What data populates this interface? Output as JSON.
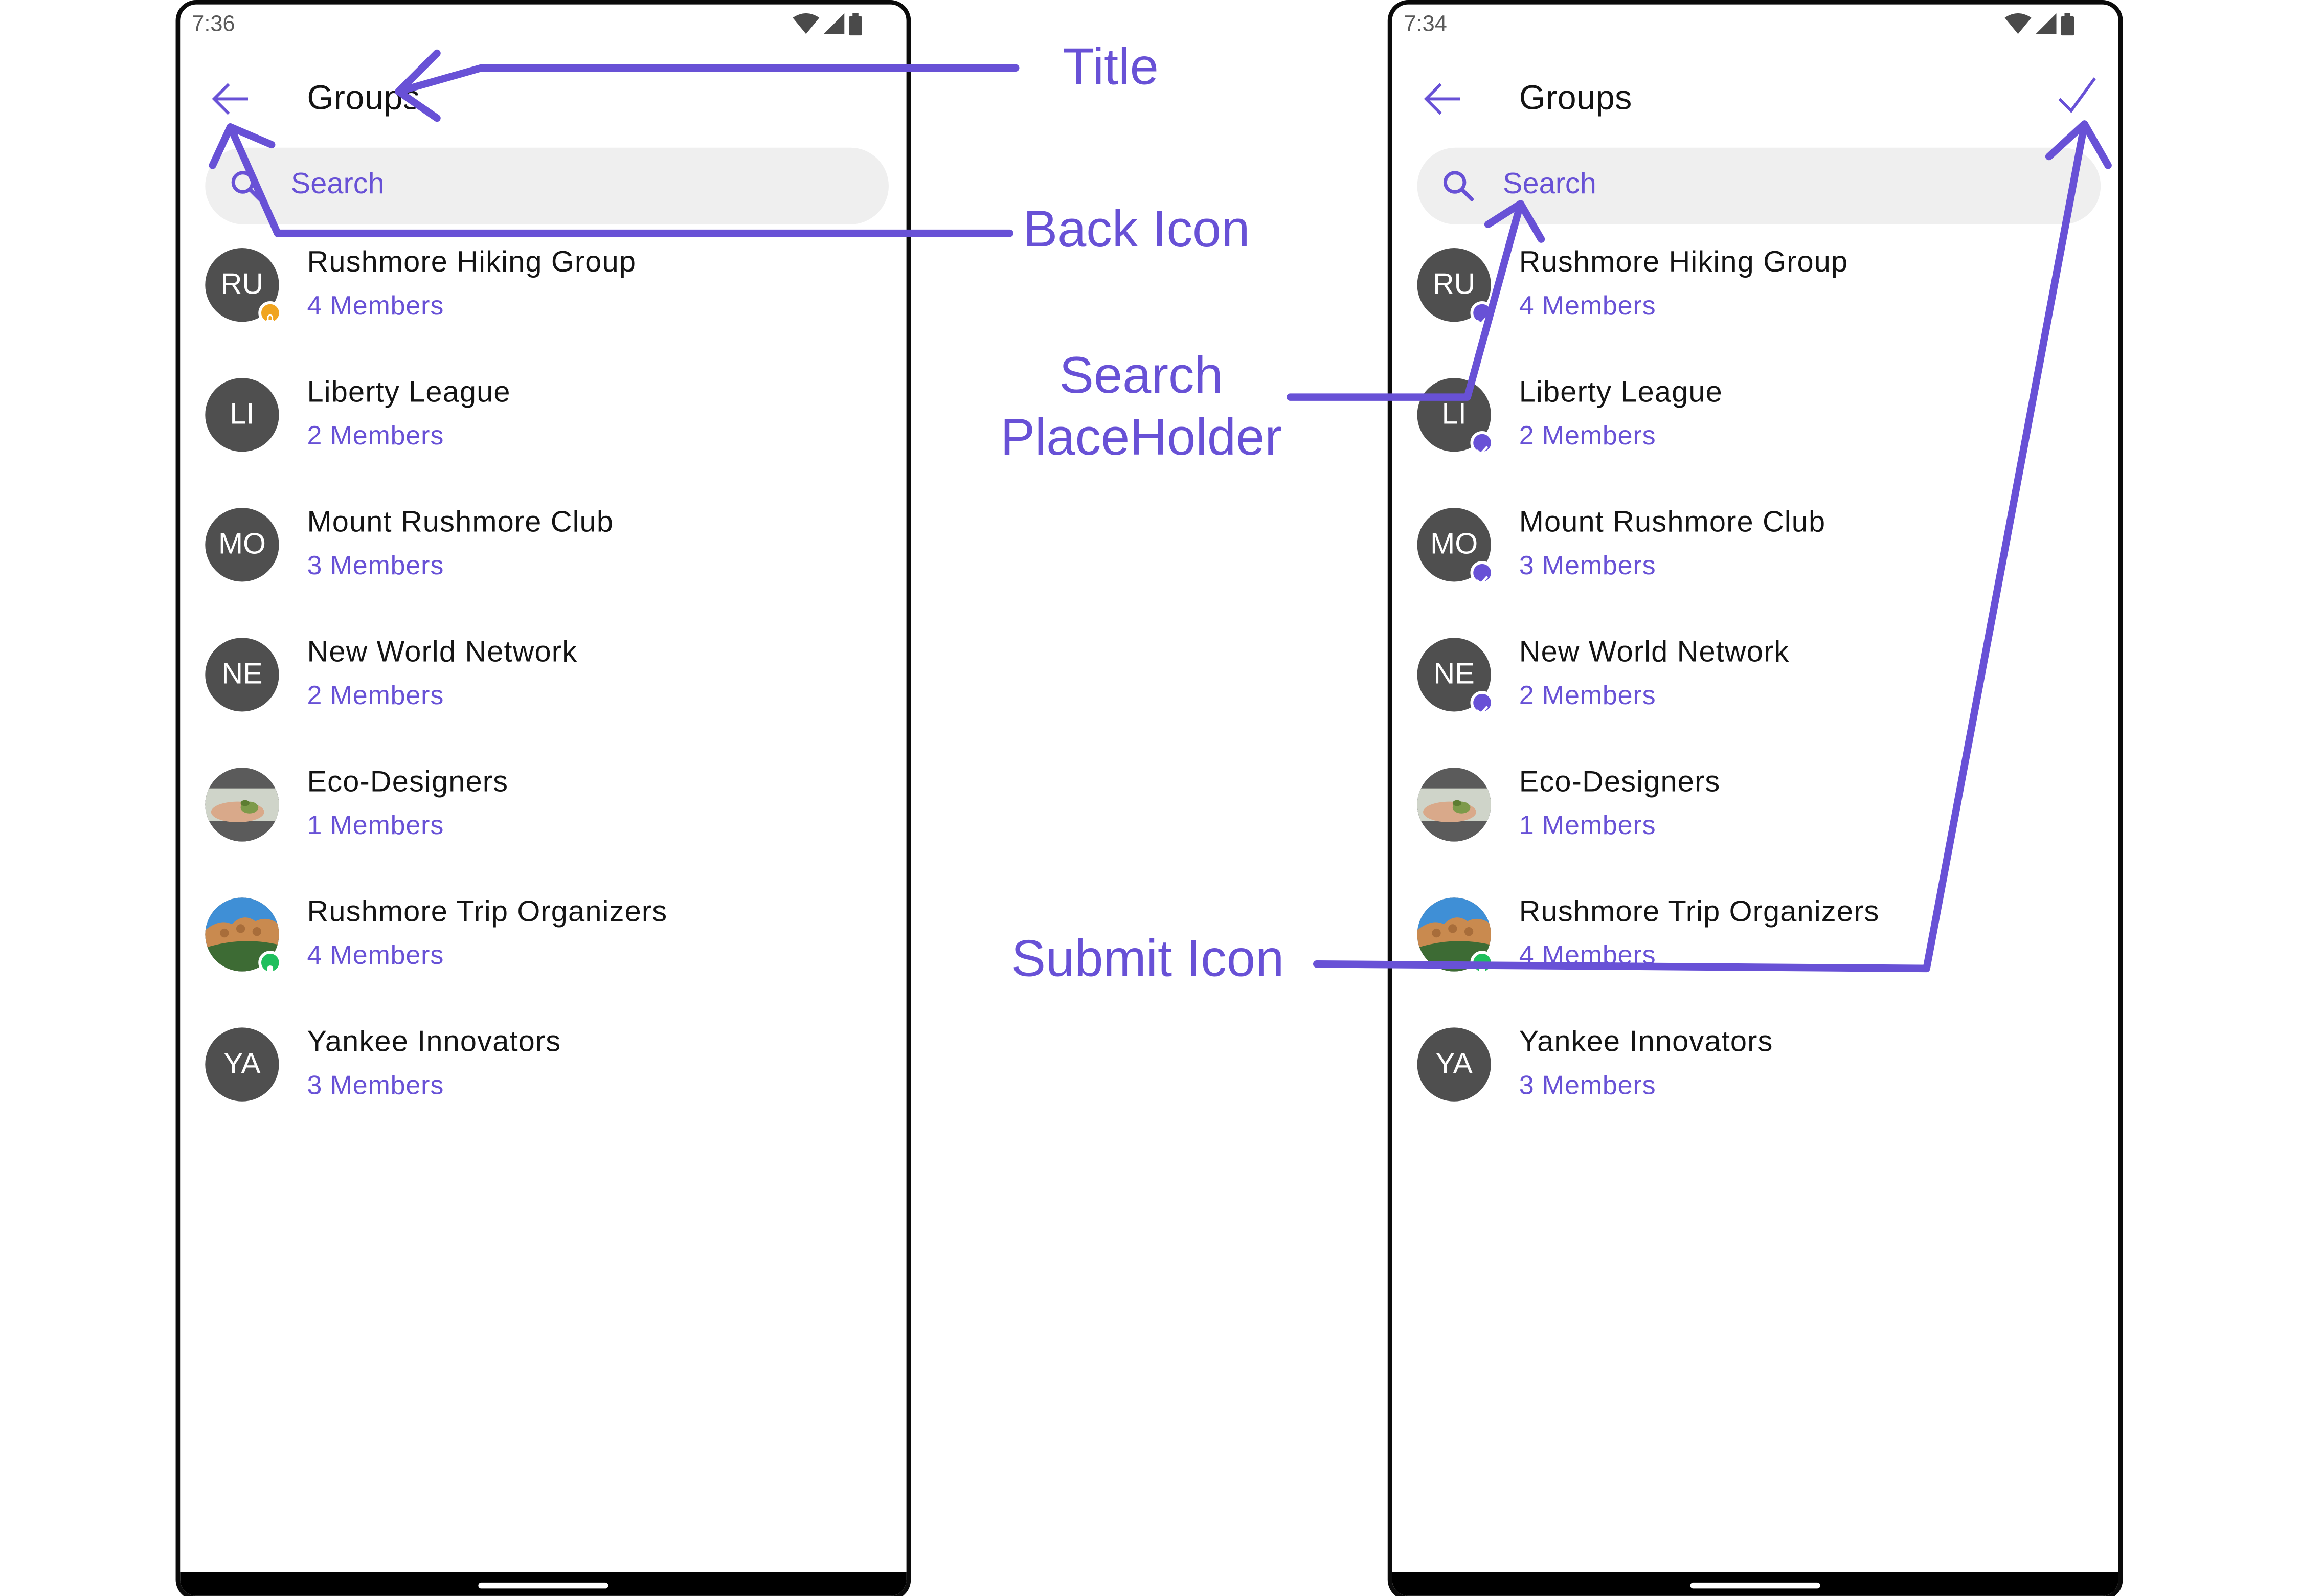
{
  "colors": {
    "accent": "#6851d6",
    "avatar_bg": "#4f4f4f",
    "search_bg": "#efefef",
    "badge_private": "#f0a41f",
    "badge_password": "#1fbf5c",
    "badge_selected": "#6851d6"
  },
  "left_screen": {
    "status_time": "7:36",
    "title": "Groups",
    "search_placeholder": "Search",
    "groups": [
      {
        "initials": "RU",
        "name": "Rushmore Hiking Group",
        "members": "4 Members",
        "badge": "private"
      },
      {
        "initials": "LI",
        "name": "Liberty League",
        "members": "2 Members",
        "badge": ""
      },
      {
        "initials": "MO",
        "name": "Mount Rushmore Club",
        "members": "3 Members",
        "badge": ""
      },
      {
        "initials": "NE",
        "name": "New World Network",
        "members": "2 Members",
        "badge": ""
      },
      {
        "initials": "",
        "name": "Eco-Designers",
        "members": "1 Members",
        "badge": "",
        "image": "hands-with-seedling"
      },
      {
        "initials": "",
        "name": "Rushmore Trip Organizers",
        "members": "4 Members",
        "badge": "password",
        "image": "mount-rushmore"
      },
      {
        "initials": "YA",
        "name": "Yankee Innovators",
        "members": "3 Members",
        "badge": ""
      }
    ]
  },
  "right_screen": {
    "status_time": "7:34",
    "title": "Groups",
    "search_placeholder": "Search",
    "submit_icon": "check-icon",
    "groups": [
      {
        "initials": "RU",
        "name": "Rushmore Hiking Group",
        "members": "4 Members",
        "badge": "selected"
      },
      {
        "initials": "LI",
        "name": "Liberty League",
        "members": "2 Members",
        "badge": "selected"
      },
      {
        "initials": "MO",
        "name": "Mount Rushmore Club",
        "members": "3 Members",
        "badge": "selected"
      },
      {
        "initials": "NE",
        "name": "New World Network",
        "members": "2 Members",
        "badge": "selected"
      },
      {
        "initials": "",
        "name": "Eco-Designers",
        "members": "1 Members",
        "badge": "",
        "image": "hands-with-seedling"
      },
      {
        "initials": "",
        "name": "Rushmore Trip Organizers",
        "members": "4 Members",
        "badge": "password",
        "image": "mount-rushmore"
      },
      {
        "initials": "YA",
        "name": "Yankee Innovators",
        "members": "3 Members",
        "badge": ""
      }
    ]
  },
  "annotations": {
    "title": "Title",
    "back_icon": "Back Icon",
    "search_line1": "Search",
    "search_line2": "PlaceHolder",
    "submit_icon": "Submit Icon"
  }
}
